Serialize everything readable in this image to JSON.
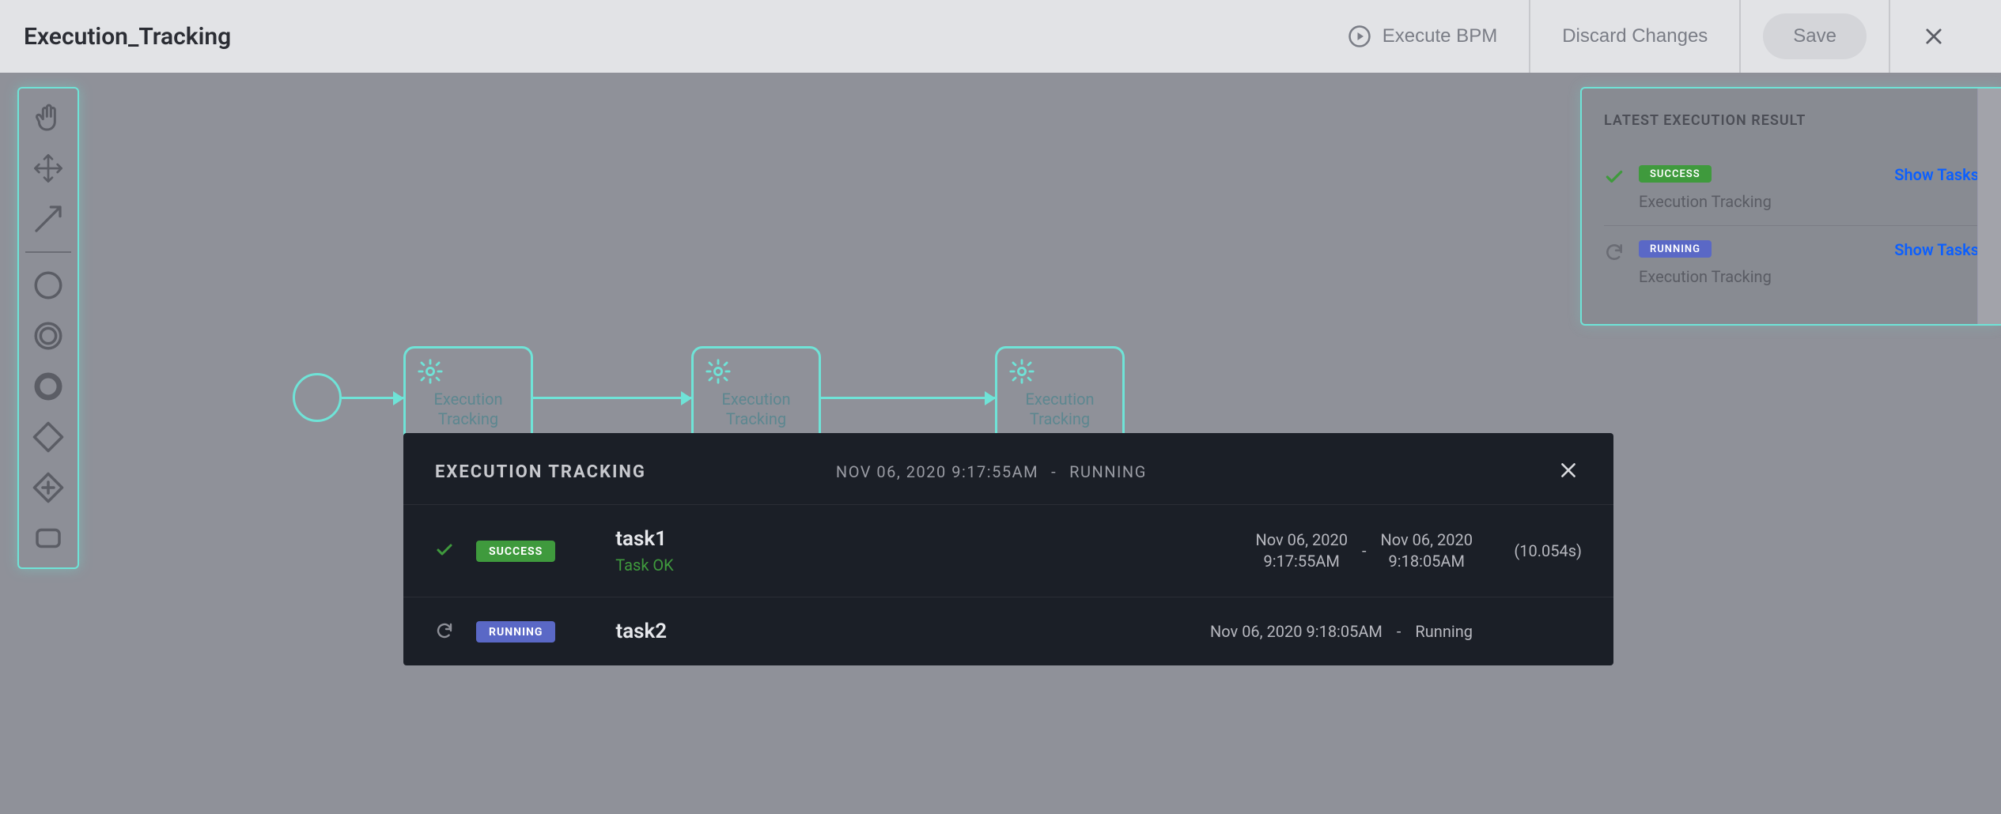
{
  "header": {
    "title": "Execution_Tracking",
    "execute_label": "Execute BPM",
    "discard_label": "Discard Changes",
    "save_label": "Save"
  },
  "flow": {
    "node1": "Execution Tracking",
    "node2": "Execution Tracking",
    "node3": "Execution Tracking"
  },
  "result_panel": {
    "title": "LATEST EXECUTION RESULT",
    "items": [
      {
        "status": "SUCCESS",
        "status_kind": "success",
        "name": "Execution Tracking",
        "link": "Show Tasks"
      },
      {
        "status": "RUNNING",
        "status_kind": "running",
        "name": "Execution Tracking",
        "link": "Show Tasks"
      }
    ]
  },
  "detail": {
    "title": "EXECUTION TRACKING",
    "start_ts": "NOV 06, 2020 9:17:55AM",
    "dash": "-",
    "status": "RUNNING",
    "rows": [
      {
        "status": "SUCCESS",
        "status_kind": "success",
        "task": "task1",
        "subtitle": "Task OK",
        "start": "Nov 06, 2020\n9:17:55AM",
        "end": "Nov 06, 2020\n9:18:05AM",
        "duration": "(10.054s)"
      },
      {
        "status": "RUNNING",
        "status_kind": "running",
        "task": "task2",
        "subtitle": "",
        "start": "Nov 06, 2020 9:18:05AM",
        "end": "Running",
        "duration": ""
      }
    ]
  },
  "icons": {
    "play": "play-circle",
    "close": "x",
    "check": "check",
    "spinner": "refresh",
    "gear": "gear"
  },
  "colors": {
    "accent_teal": "#6fe3d7",
    "dark_panel": "#1b1f27",
    "success_green": "#3f9a3d",
    "running_purple": "#5a68c6",
    "link_blue": "#0b5fff",
    "canvas_gray": "#8f9199",
    "header_gray": "#e2e3e6"
  }
}
